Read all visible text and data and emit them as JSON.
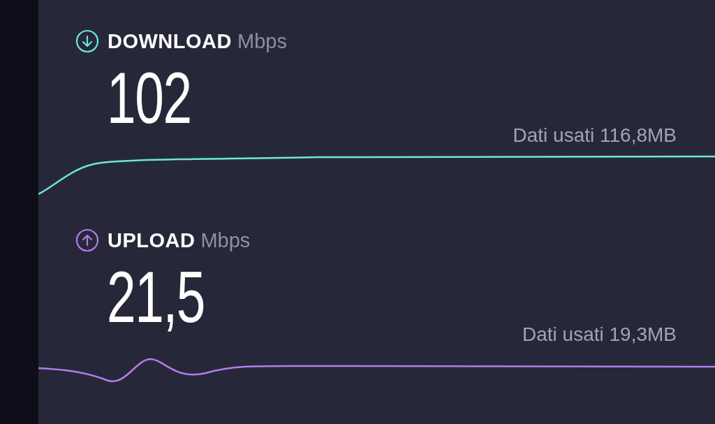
{
  "sections": [
    {
      "kind": "download",
      "label": "DOWNLOAD",
      "unit": "Mbps",
      "value": "102",
      "data_used": "Dati usati 116,8MB",
      "color": "#6ee6dc"
    },
    {
      "kind": "upload",
      "label": "UPLOAD",
      "unit": "Mbps",
      "value": "21,5",
      "data_used": "Dati usati 19,3MB",
      "color": "#b57ae8"
    }
  ]
}
